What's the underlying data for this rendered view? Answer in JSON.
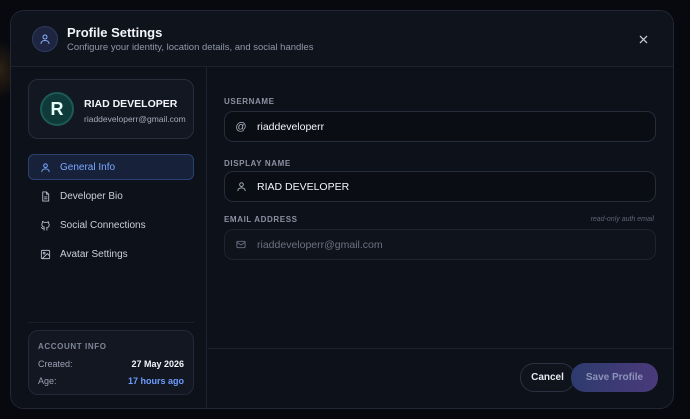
{
  "header": {
    "title": "Profile Settings",
    "subtitle": "Configure your identity, location details, and social handles"
  },
  "profile": {
    "avatar_letter": "R",
    "name": "RIAD DEVELOPER",
    "email": "riaddeveloperr@gmail.com"
  },
  "nav": {
    "items": [
      {
        "label": "General Info",
        "icon": "user-icon",
        "active": true
      },
      {
        "label": "Developer Bio",
        "icon": "document-icon",
        "active": false
      },
      {
        "label": "Social Connections",
        "icon": "github-icon",
        "active": false
      },
      {
        "label": "Avatar Settings",
        "icon": "image-icon",
        "active": false
      }
    ]
  },
  "account": {
    "title": "ACCOUNT INFO",
    "created_label": "Created:",
    "created_value": "27 May 2026",
    "age_label": "Age:",
    "age_value": "17 hours ago"
  },
  "form": {
    "username": {
      "label": "USERNAME",
      "value": "riaddeveloperr",
      "icon": "at-icon"
    },
    "display_name": {
      "label": "DISPLAY NAME",
      "value": "RIAD DEVELOPER",
      "icon": "user-icon"
    },
    "email": {
      "label": "EMAIL ADDRESS",
      "hint": "read-only auth email",
      "value": "riaddeveloperr@gmail.com",
      "icon": "mail-icon"
    }
  },
  "footer": {
    "cancel_label": "Cancel",
    "save_label": "Save Profile"
  },
  "colors": {
    "accent": "#6f9cff",
    "background": "#0d1119"
  }
}
